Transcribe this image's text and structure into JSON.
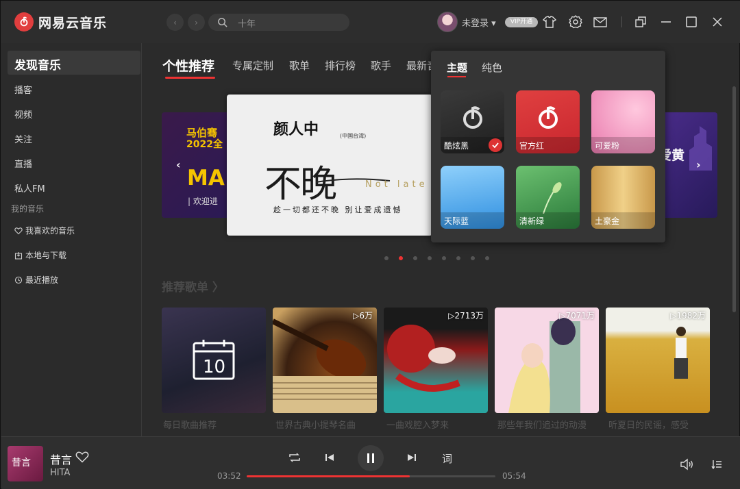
{
  "app": {
    "title": "网易云音乐"
  },
  "header": {
    "search_placeholder": "十年",
    "login_label": "未登录",
    "vip_label": "VIP开通"
  },
  "sidebar": {
    "active": "发现音乐",
    "items": [
      "播客",
      "视频",
      "关注",
      "直播",
      "私人FM"
    ],
    "section_title": "我的音乐",
    "my_music": [
      "我喜欢的音乐",
      "本地与下载",
      "最近播放"
    ]
  },
  "tabs": [
    "个性推荐",
    "专属定制",
    "歌单",
    "排行榜",
    "歌手",
    "最新音"
  ],
  "banner": {
    "left": {
      "line1": "马伯骞",
      "line2": "2022全",
      "big": "MA",
      "sub": "| 欢迎进"
    },
    "main": {
      "artist": "颜人中",
      "region": "(中国台湾)",
      "title": "不晚",
      "english": "Not late",
      "lyric": "趁一切都还不晚  别让爱成遗憾"
    },
    "right": {
      "text": "爱黄"
    },
    "dots_count": 8,
    "active_dot": 1
  },
  "section": {
    "title": "推荐歌单 〉"
  },
  "playlists": [
    {
      "plays": "",
      "caption": "每日歌曲推荐",
      "calendar_day": "10"
    },
    {
      "plays": "▷6万",
      "caption": "世界古典小提琴名曲"
    },
    {
      "plays": "▷2713万",
      "caption": "一曲戏腔入梦来"
    },
    {
      "plays": "▷7071万",
      "caption": "那些年我们追过的动漫"
    },
    {
      "plays": "▷1982万",
      "caption": "听夏日的民谣，感受"
    }
  ],
  "theme_popup": {
    "tabs": [
      "主题",
      "纯色"
    ],
    "themes": [
      {
        "name": "酷炫黑",
        "color": "#2e2e2e",
        "selected": true
      },
      {
        "name": "官方红",
        "color": "#d8333a",
        "selected": false
      },
      {
        "name": "可爱粉",
        "color": "#f08bb6",
        "selected": false
      },
      {
        "name": "天际蓝",
        "color": "#4aa6ea",
        "selected": false
      },
      {
        "name": "清新绿",
        "color": "#3c9a4c",
        "selected": false
      },
      {
        "name": "土豪金",
        "color": "#d9b25a",
        "selected": false
      }
    ]
  },
  "player": {
    "song": "昔言",
    "artist": "HITA",
    "cover_text": "昔言",
    "current_time": "03:52",
    "total_time": "05:54",
    "progress": 0.655,
    "lyric_button": "词"
  },
  "colors": {
    "accent": "#e33333",
    "background": "#2b2b2b"
  }
}
